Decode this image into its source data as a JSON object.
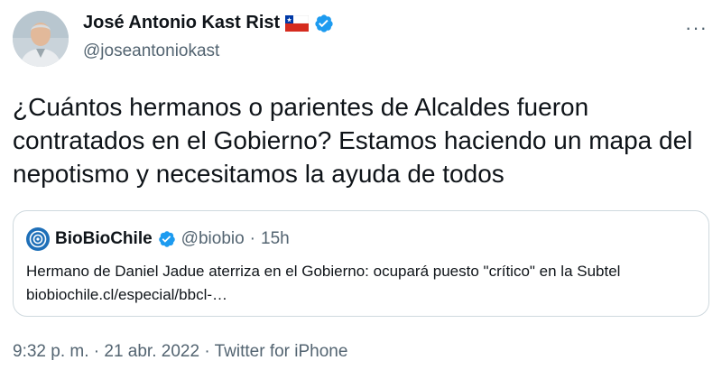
{
  "author": {
    "display_name": "José Antonio Kast Rist",
    "handle": "@joseantoniokast",
    "avatar_icon": "profile-photo",
    "flag_icon": "chile-flag-icon",
    "verified_icon": "verified-badge-icon"
  },
  "more_label": "···",
  "tweet": {
    "text": "¿Cuántos hermanos o parientes de Alcaldes fueron contratados en el Gobierno? Estamos haciendo un mapa del nepotismo y necesitamos la ayuda de todos"
  },
  "quote": {
    "logo_icon": "biobio-logo-icon",
    "name": "BioBioChile",
    "handle": "@biobio",
    "separator": "·",
    "time": "15h",
    "text": "Hermano de Daniel Jadue aterriza en el Gobierno: ocupará puesto \"crítico\" en la Subtel",
    "link": "biobiochile.cl/especial/bbcl-…"
  },
  "footer": {
    "time": "9:32 p. m.",
    "sep1": " · ",
    "date": "21 abr. 2022",
    "sep2": " · ",
    "source": "Twitter for iPhone"
  },
  "colors": {
    "verified": "#1d9bf0",
    "secondary_text": "#536471",
    "border": "#cfd9de",
    "biobio_blue": "#1e6fb8"
  }
}
